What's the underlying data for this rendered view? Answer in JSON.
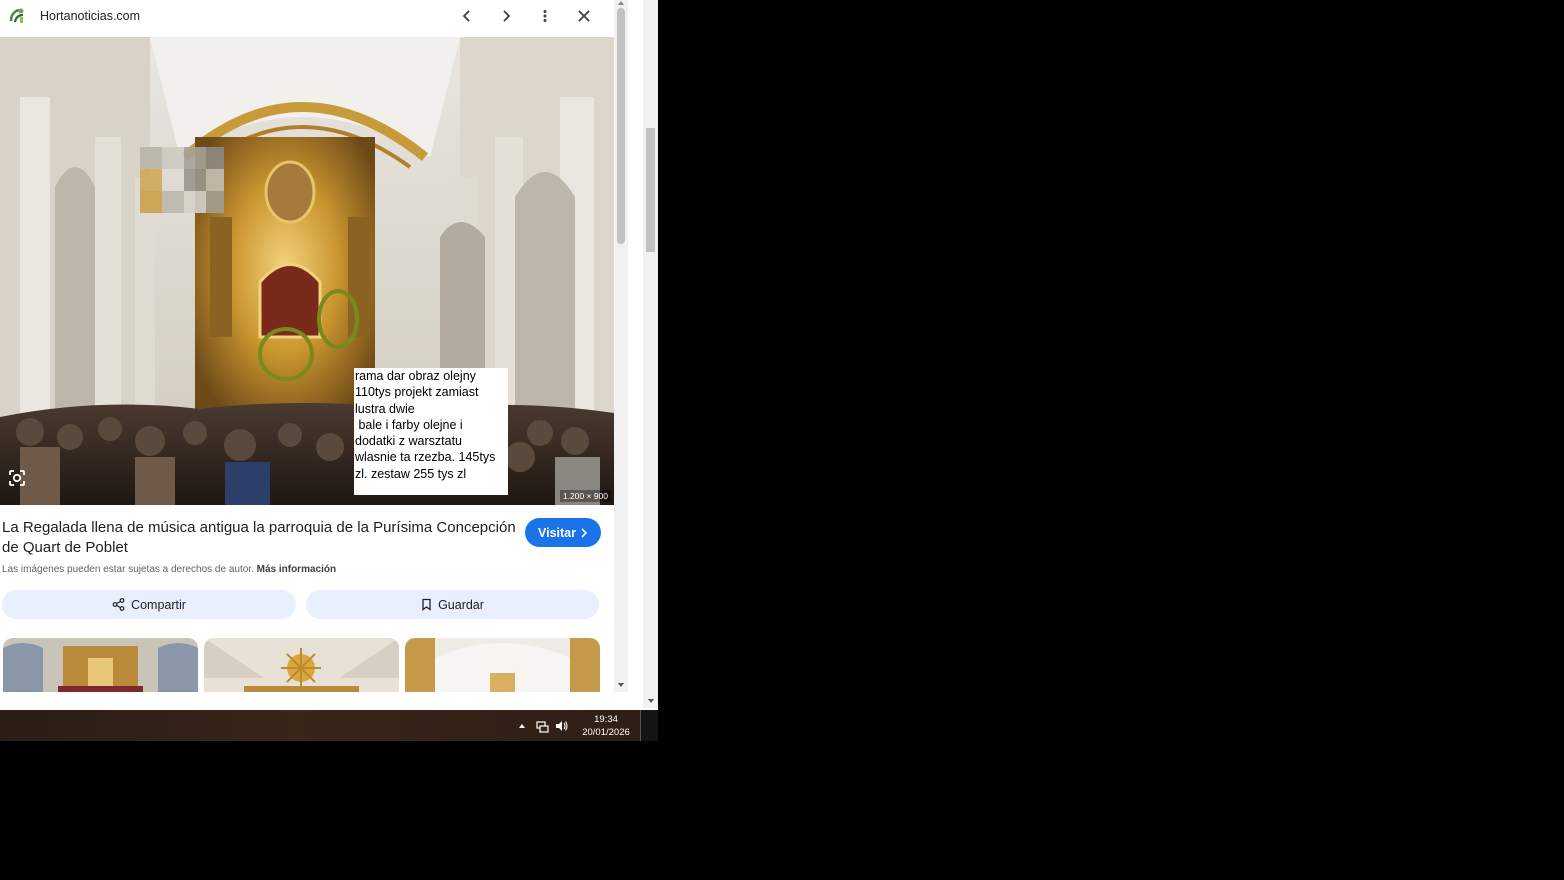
{
  "header": {
    "site_name": "Hortanoticias.com",
    "icons": [
      "site-logo-icon",
      "chevron-left-icon",
      "chevron-right-icon",
      "more-vert-icon",
      "close-icon"
    ]
  },
  "image": {
    "dimensions": "1.200 × 900",
    "note_lines": [
      "rama dar obraz olejny",
      "110tys projekt zamiast",
      "lustra dwie",
      " bale i farby olejne i",
      "dodatki z warsztatu",
      "wlasnie ta rzezba. 145tys",
      "zl. zestaw 255 tys zl"
    ],
    "icons": [
      "lens-icon"
    ]
  },
  "result": {
    "title": "La Regalada llena de música antigua la parroquia de la Purísima Concepción de Quart de Poblet",
    "visit_label": "Visitar",
    "copyright_text": "Las imágenes pueden estar sujetas a derechos de autor.",
    "more_info_label": "Más información"
  },
  "actions": {
    "share_label": "Compartir",
    "save_label": "Guardar"
  },
  "taskbar": {
    "time": "19:34",
    "date": "20/01/2026"
  },
  "colors": {
    "accent": "#1a73e8",
    "action_bg": "#e8f0fe",
    "annotation_circle": "#7a8a1a"
  }
}
